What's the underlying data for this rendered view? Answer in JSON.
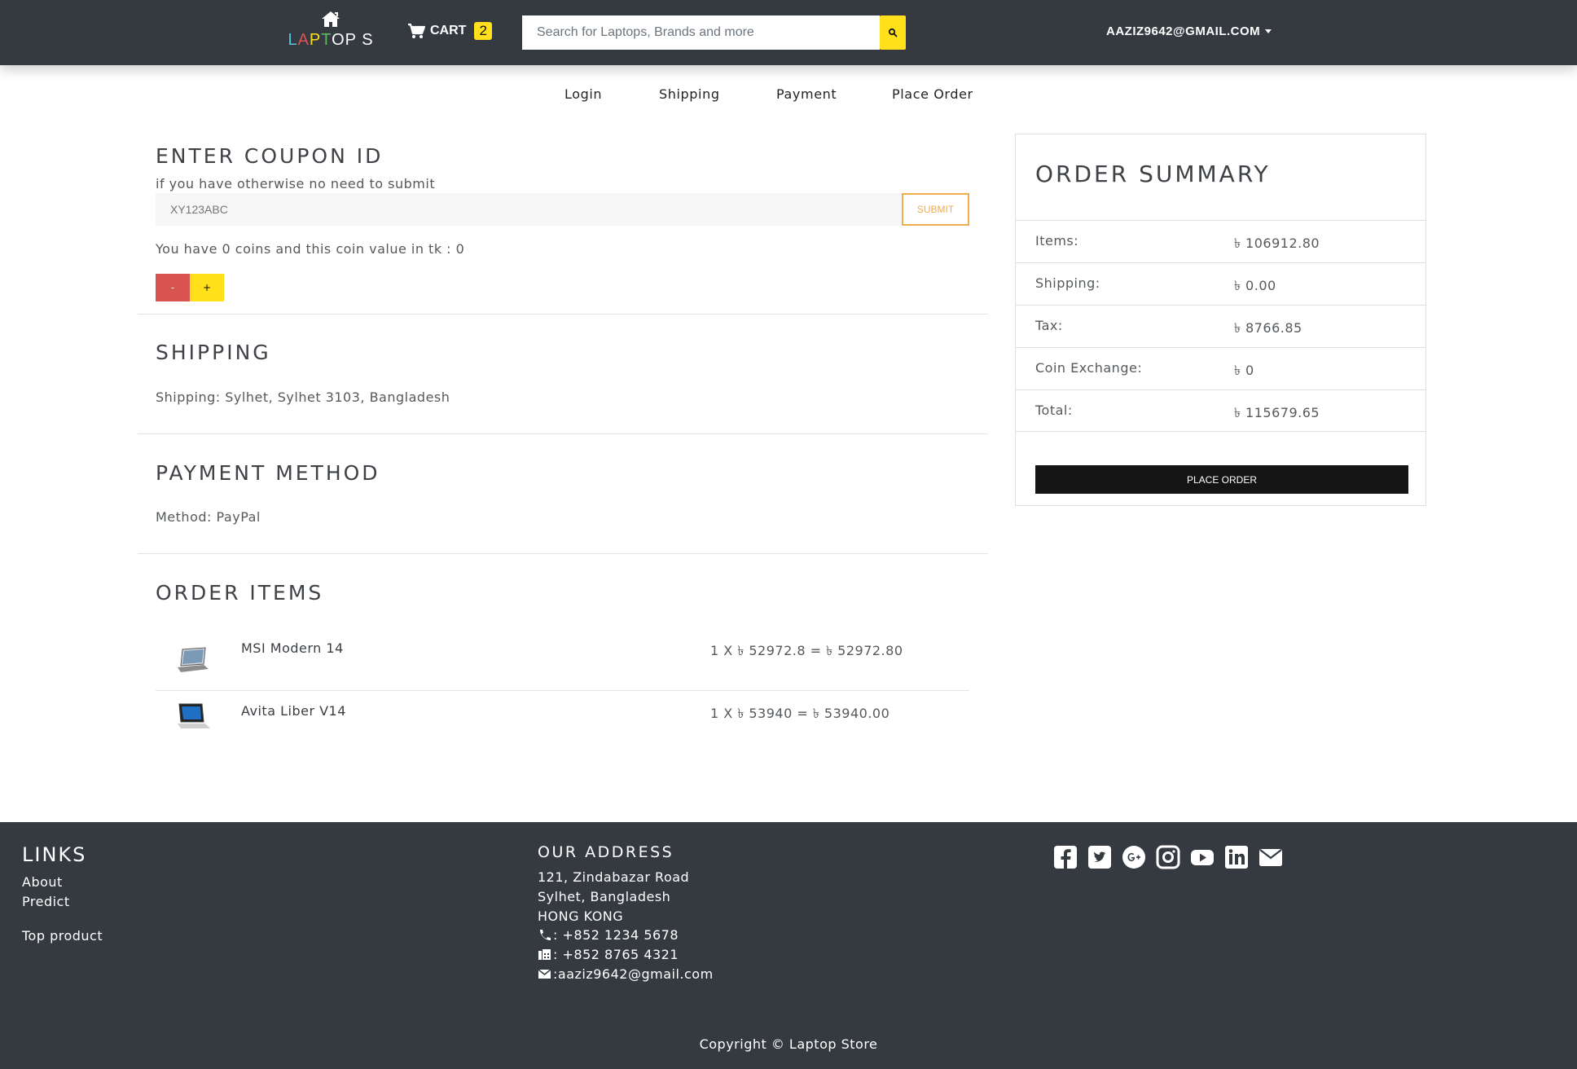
{
  "header": {
    "brand_text": "LAPTOP S",
    "cart_label": "CART",
    "cart_count": "2",
    "search_placeholder": "Search for Laptops, Brands and more",
    "user_email": "AAZIZ9642@GMAIL.COM"
  },
  "steps": [
    "Login",
    "Shipping",
    "Payment",
    "Place Order"
  ],
  "coupon": {
    "title": "ENTER COUPON ID",
    "hint": "if you have otherwise no need to submit",
    "placeholder": "XY123ABC",
    "submit_label": "SUBMIT",
    "coins_text": "You have 0 coins and this coin value in tk : 0",
    "minus_label": "-",
    "plus_label": "+"
  },
  "shipping": {
    "title": "SHIPPING",
    "text": "Shipping: Sylhet, Sylhet 3103, Bangladesh"
  },
  "payment": {
    "title": "PAYMENT METHOD",
    "text": "Method: PayPal"
  },
  "order_items": {
    "title": "ORDER ITEMS",
    "items": [
      {
        "name": "MSI Modern 14",
        "price_line": "1 X ৳ 52972.8 = ৳ 52972.80"
      },
      {
        "name": "Avita Liber V14",
        "price_line": "1 X ৳ 53940 = ৳ 53940.00"
      }
    ]
  },
  "summary": {
    "title": "ORDER SUMMARY",
    "rows": [
      {
        "label": "Items:",
        "value": "৳ 106912.80"
      },
      {
        "label": "Shipping:",
        "value": "৳ 0.00"
      },
      {
        "label": "Tax:",
        "value": "৳ 8766.85"
      },
      {
        "label": "Coin Exchange:",
        "value": "৳ 0"
      },
      {
        "label": "Total:",
        "value": "৳ 115679.65"
      }
    ],
    "place_order_label": "PLACE ORDER"
  },
  "footer": {
    "links_title": "LINKS",
    "links": [
      "About",
      "Predict",
      "Top product"
    ],
    "address_title": "OUR ADDRESS",
    "address_lines": [
      "121, Zindabazar Road",
      "Sylhet, Bangladesh",
      "HONG KONG"
    ],
    "phone": ": +852 1234 5678",
    "fax": ": +852 8765 4321",
    "email": ":aaziz9642@gmail.com",
    "social_icons": [
      "facebook-icon",
      "twitter-icon",
      "google-plus-icon",
      "instagram-icon",
      "youtube-icon",
      "linkedin-icon",
      "envelope-icon"
    ],
    "copyright": "Copyright © Laptop Store"
  },
  "colors": {
    "header_bg": "#343a40",
    "accent_yellow": "#ffe01b",
    "danger_red": "#d9534f",
    "submit_orange": "#f0ad4e",
    "place_order_bg": "#141414"
  }
}
